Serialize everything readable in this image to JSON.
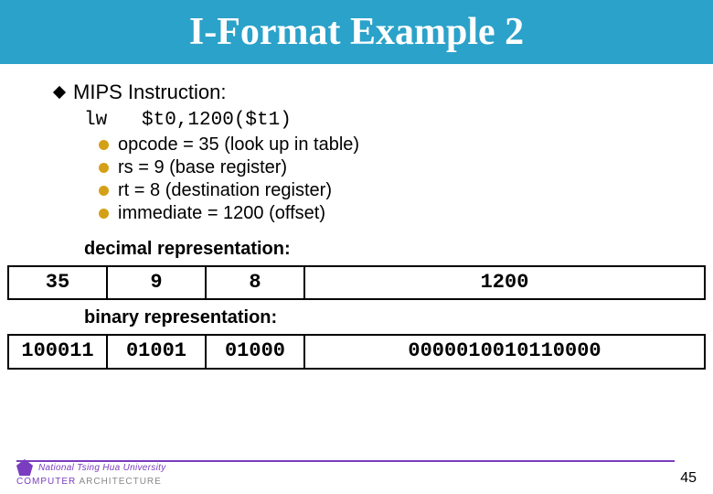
{
  "title": "I-Format Example 2",
  "main_bullet": "MIPS Instruction:",
  "code_line": "lw   $t0,1200($t1)",
  "subitems": [
    "opcode = 35 (look up in table)",
    "rs = 9 (base register)",
    "rt = 8 (destination register)",
    "immediate = 1200 (offset)"
  ],
  "decimal_label": "decimal representation:",
  "decimal_fields": {
    "op": "35",
    "rs": "9",
    "rt": "8",
    "imm": "1200"
  },
  "binary_label": "binary representation:",
  "binary_fields": {
    "op": "100011",
    "rs": "01001",
    "rt": "01000",
    "imm": "0000010010110000"
  },
  "footer": {
    "university": "National Tsing Hua University",
    "dept_cs": "COMPUTER",
    "dept_arch": "ARCHITECTURE",
    "page": "45"
  }
}
